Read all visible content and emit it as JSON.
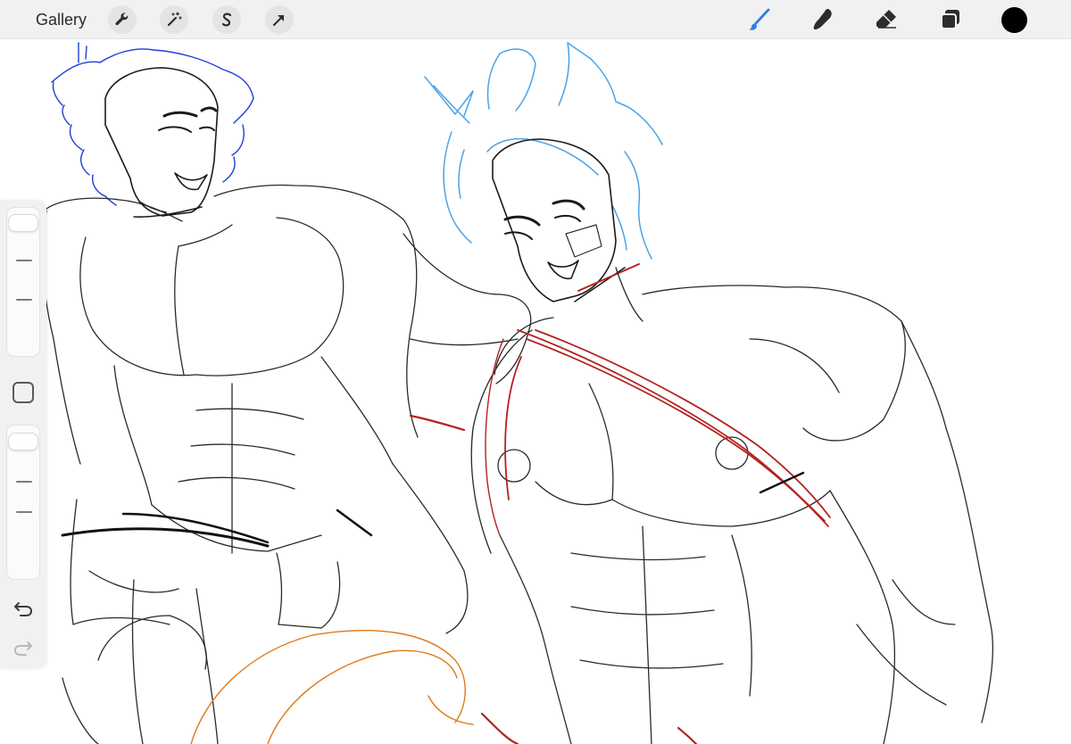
{
  "topbar": {
    "gallery_label": "Gallery",
    "left_tools": [
      {
        "name": "actions",
        "icon": "wrench-icon"
      },
      {
        "name": "adjustments",
        "icon": "magic-wand-icon"
      },
      {
        "name": "selection",
        "icon": "s-selection-icon"
      },
      {
        "name": "transform",
        "icon": "arrow-cursor-icon"
      }
    ],
    "right_tools": [
      {
        "name": "brush",
        "icon": "brush-icon",
        "active": true
      },
      {
        "name": "smudge",
        "icon": "smudge-finger-icon",
        "active": false
      },
      {
        "name": "eraser",
        "icon": "eraser-icon",
        "active": false
      },
      {
        "name": "layers",
        "icon": "layers-icon",
        "active": false
      }
    ],
    "current_color": "#000000"
  },
  "sidebar": {
    "brush_size_level": 0.95,
    "opacity_level": 0.95,
    "modifier_icon": "square-modifier-icon",
    "undo_icon": "undo-arrow-icon",
    "redo_icon": "redo-arrow-icon"
  },
  "colors": {
    "accent": "#2f7fe6",
    "line_black": "#1a1a1a",
    "line_blue": "#1a3fd6",
    "line_lightblue": "#4aa3e8",
    "line_red": "#b3221f",
    "line_orange": "#e07a1a"
  }
}
